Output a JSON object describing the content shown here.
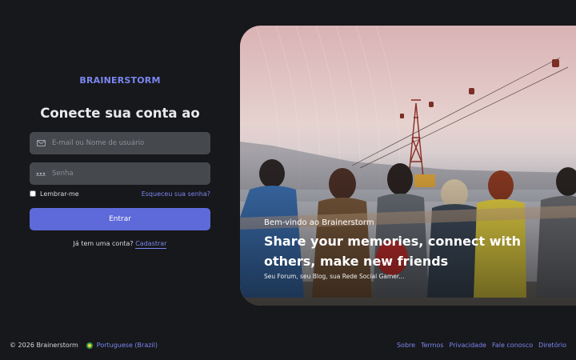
{
  "brand": "BRAINERSTORM",
  "login": {
    "headline": "Conecte sua conta ao",
    "email_placeholder": "E-mail ou Nome de usuário",
    "password_placeholder": "Senha",
    "remember_label": "Lembrar-me",
    "forgot_link": "Esqueceu sua senha?",
    "submit_label": "Entrar",
    "signup_prompt": "Já tem uma conta?",
    "signup_link": "Cadastrar"
  },
  "hero": {
    "welcome": "Bem-vindo ao Brainerstorm",
    "tagline": "Share your memories, connect with others, make new friends",
    "subtitle": "Seu Forum, seu Blog, sua Rede Social Gamer..."
  },
  "footer": {
    "copyright": "© 2026 Brainerstorm",
    "language": "Portuguese (Brazil)",
    "links": [
      "Sobre",
      "Termos",
      "Privacidade",
      "Fale conosco",
      "Diretório"
    ]
  },
  "colors": {
    "accent": "#7b86f0",
    "button": "#5e6ad9",
    "background": "#17181b",
    "field": "#45484d"
  },
  "icons": {
    "email": "envelope-icon",
    "password": "password-dots-icon",
    "language": "brazil-flag-icon"
  }
}
